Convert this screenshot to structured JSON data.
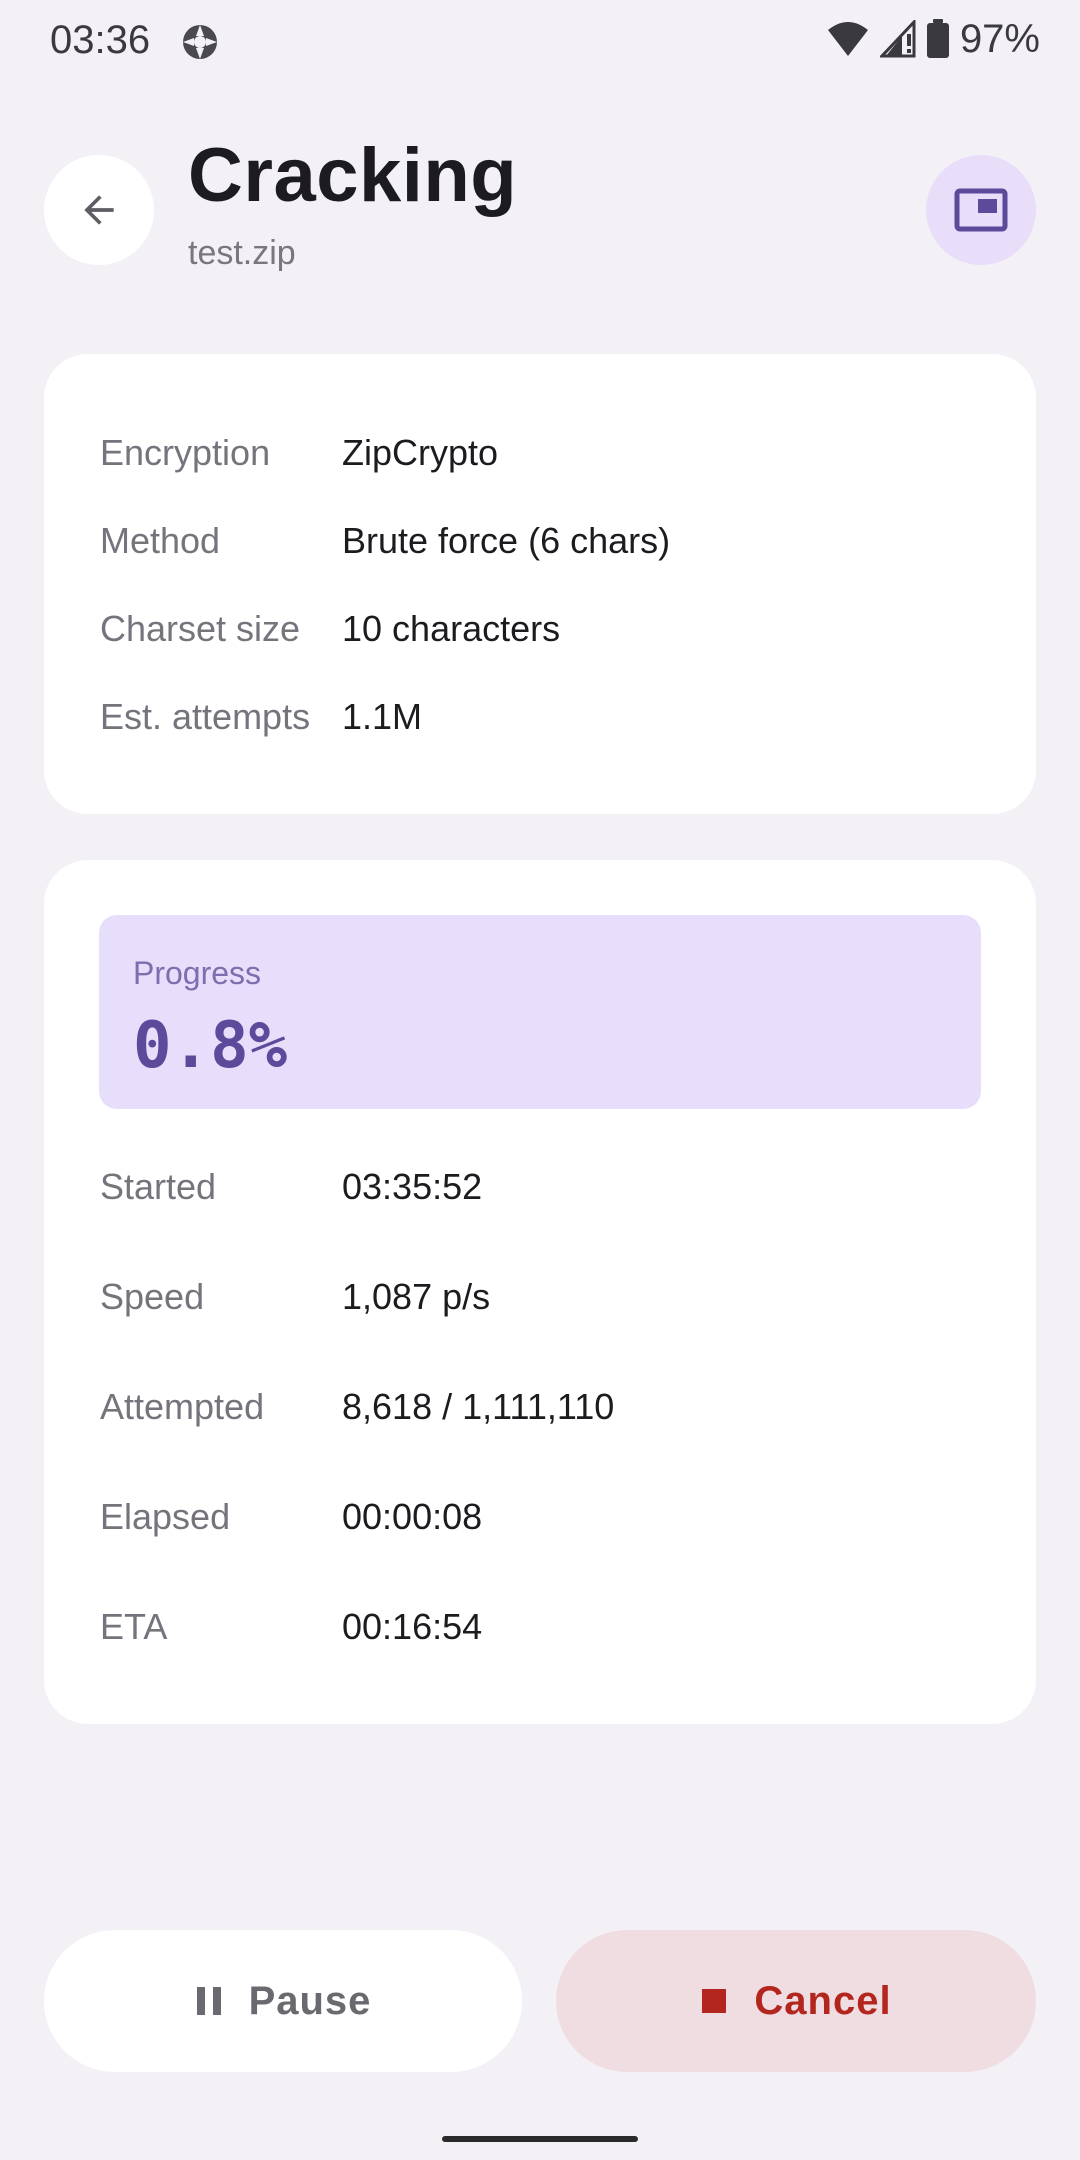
{
  "status_bar": {
    "time": "03:36",
    "battery": "97%"
  },
  "header": {
    "title": "Cracking",
    "subtitle": "test.zip"
  },
  "info": [
    {
      "label": "Encryption",
      "value": "ZipCrypto"
    },
    {
      "label": "Method",
      "value": "Brute force (6 chars)"
    },
    {
      "label": "Charset size",
      "value": "10 characters"
    },
    {
      "label": "Est. attempts",
      "value": "1.1M"
    }
  ],
  "progress": {
    "label": "Progress",
    "value": "0.8%"
  },
  "stats": [
    {
      "label": "Started",
      "value": "03:35:52"
    },
    {
      "label": "Speed",
      "value": "1,087 p/s"
    },
    {
      "label": "Attempted",
      "value": "8,618 / 1,111,110"
    },
    {
      "label": "Elapsed",
      "value": "00:00:08"
    },
    {
      "label": "ETA",
      "value": "00:16:54"
    }
  ],
  "buttons": {
    "pause": "Pause",
    "cancel": "Cancel"
  },
  "icons": {
    "back": "arrow-left-icon",
    "pip": "picture-in-picture-icon",
    "pause": "pause-icon",
    "stop": "stop-icon"
  },
  "colors": {
    "accent": "#5b4b9a",
    "accent_container": "#e6defb",
    "danger": "#b3261e",
    "danger_container": "#efdde1",
    "background": "#f4f1f6"
  }
}
